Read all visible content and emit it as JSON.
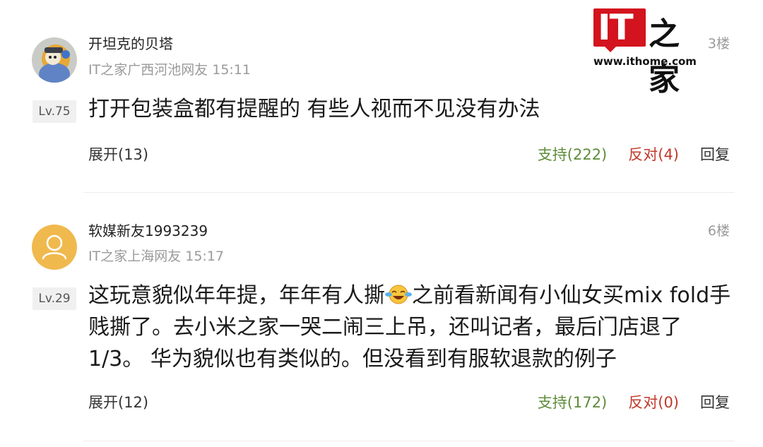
{
  "watermark": {
    "mark_text": "IT",
    "chars": "之家",
    "url": "www.ithome.com"
  },
  "comments": [
    {
      "username": "开坦克的贝塔",
      "meta": "IT之家广西河池网友 15:11",
      "floor": "3楼",
      "level": "Lv.75",
      "content": "打开包装盒都有提醒的 有些人视而不见没有办法",
      "expand": "展开(13)",
      "support": "支持(222)",
      "oppose": "反对(4)",
      "reply": "回复"
    },
    {
      "username": "软媒新友1993239",
      "meta": "IT之家上海网友 15:17",
      "floor": "6楼",
      "level": "Lv.29",
      "content_part1": "这玩意貌似年年提，年年有人撕",
      "emoji": "crying-laughing-emoji",
      "content_part2": "之前看新闻有小仙女买mix fold手贱撕了。去小米之家一哭二闹三上吊，还叫记者，最后门店退了1/3。 华为貌似也有类似的。但没看到有服软退款的例子",
      "expand": "展开(12)",
      "support": "支持(172)",
      "oppose": "反对(0)",
      "reply": "回复"
    }
  ],
  "colors": {
    "support": "#5e8c3a",
    "oppose": "#c0392b",
    "brand": "#d3131e",
    "meta": "#9a9a9a",
    "default_avatar_bg": "#f0b94e"
  }
}
